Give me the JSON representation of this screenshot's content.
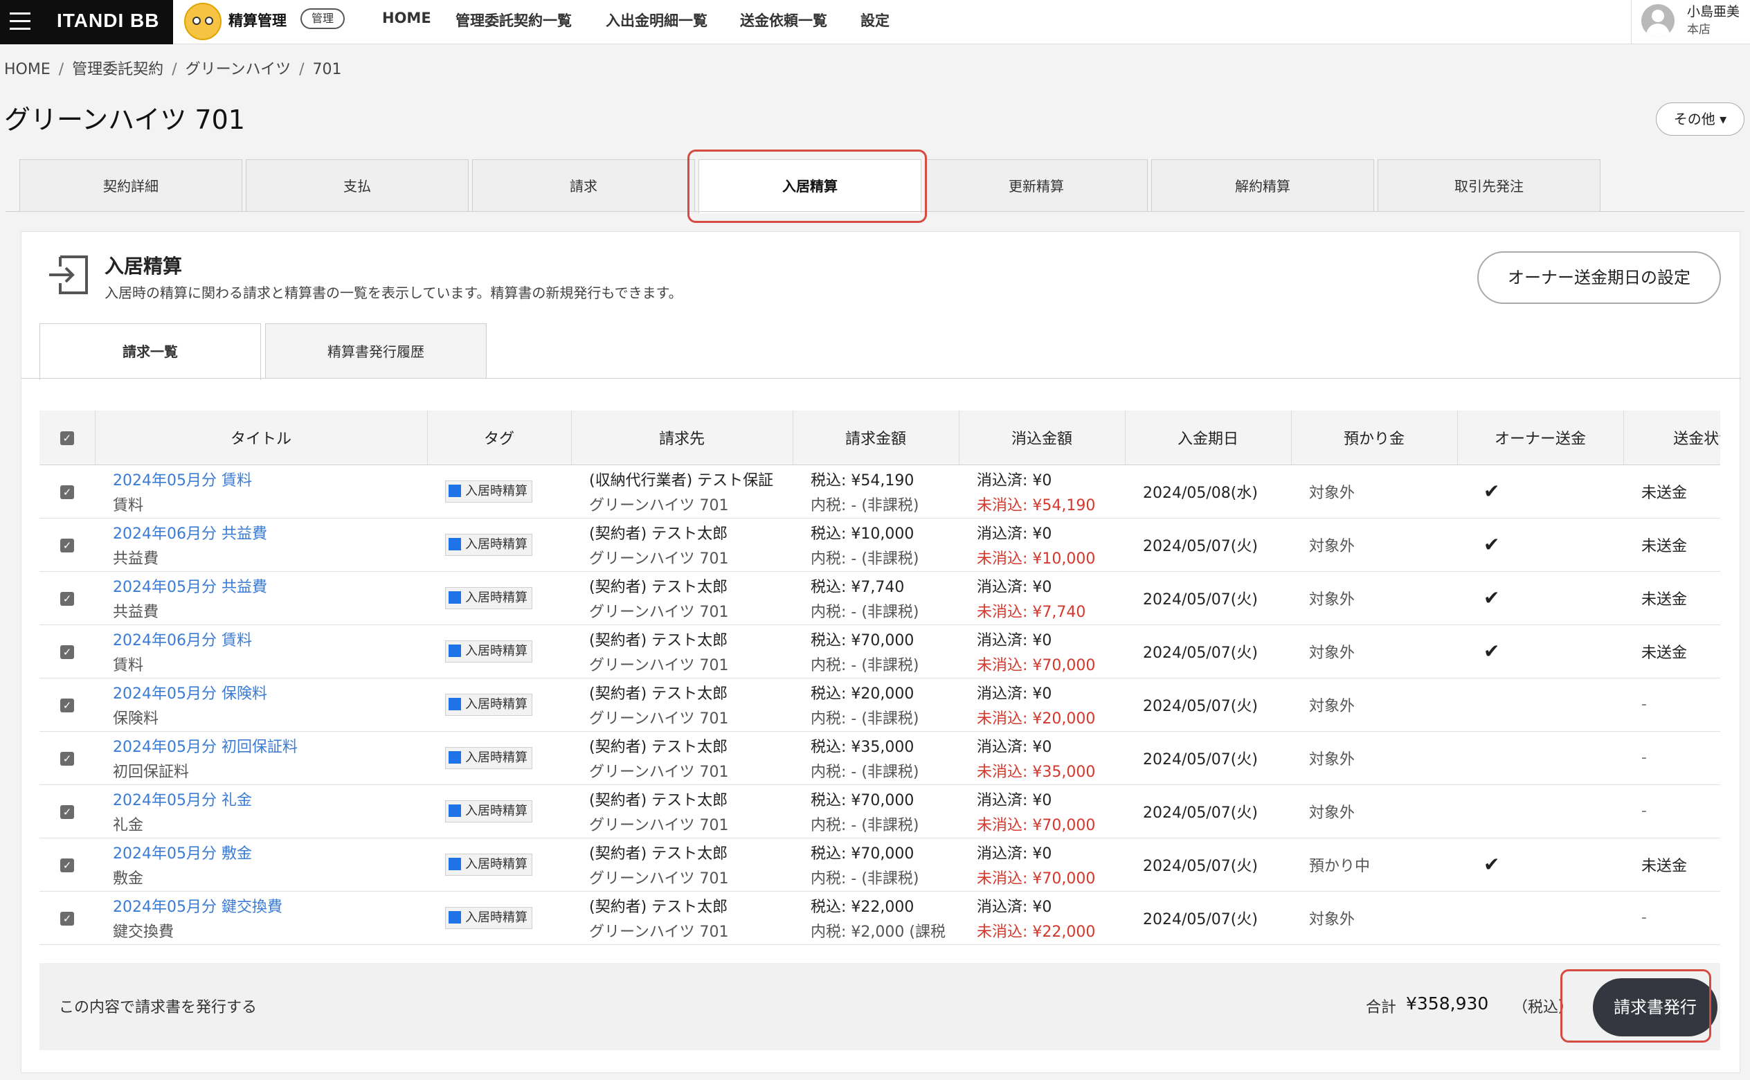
{
  "brand": {
    "name": "ITANDI BB"
  },
  "app": {
    "name": "精算管理",
    "badge": "管理"
  },
  "nav": [
    "HOME",
    "管理委託契約一覧",
    "入出金明細一覧",
    "送金依頼一覧",
    "設定"
  ],
  "user": {
    "name": "小島亜美",
    "branch": "本店"
  },
  "breadcrumb": [
    "HOME",
    "管理委託契約",
    "グリーンハイツ",
    "701"
  ],
  "page_title": "グリーンハイツ 701",
  "other_button": "その他 ▾",
  "tabs": [
    "契約詳細",
    "支払",
    "請求",
    "入居精算",
    "更新精算",
    "解約精算",
    "取引先発注"
  ],
  "active_tab": "入居精算",
  "section": {
    "title": "入居精算",
    "description": "入居時の精算に関わる請求と精算書の一覧を表示しています。精算書の新規発行もできます。",
    "owner_button": "オーナー送金期日の設定",
    "icon": "move-in-icon"
  },
  "subtabs": [
    "請求一覧",
    "精算書発行履歴"
  ],
  "table": {
    "headers": [
      "タイトル",
      "タグ",
      "請求先",
      "請求金額",
      "消込金額",
      "入金期日",
      "預かり金",
      "オーナー送金",
      "送金状況"
    ],
    "rows": [
      {
        "title": "2024年05月分 賃料",
        "subtitle": "賃料",
        "tag": "入居時精算",
        "payer": "(収納代行業者) テスト保証",
        "payer_sub": "グリーンハイツ 701",
        "amount": "税込: ¥54,190",
        "tax": "内税: - (非課税)",
        "cleared": "消込済: ¥0",
        "uncleared": "未消込: ¥54,190",
        "due": "2024/05/08(水)",
        "deposit": "対象外",
        "owner": "✔",
        "status": "未送金"
      },
      {
        "title": "2024年06月分 共益費",
        "subtitle": "共益費",
        "tag": "入居時精算",
        "payer": "(契約者) テスト太郎",
        "payer_sub": "グリーンハイツ 701",
        "amount": "税込: ¥10,000",
        "tax": "内税: - (非課税)",
        "cleared": "消込済: ¥0",
        "uncleared": "未消込: ¥10,000",
        "due": "2024/05/07(火)",
        "deposit": "対象外",
        "owner": "✔",
        "status": "未送金"
      },
      {
        "title": "2024年05月分 共益費",
        "subtitle": "共益費",
        "tag": "入居時精算",
        "payer": "(契約者) テスト太郎",
        "payer_sub": "グリーンハイツ 701",
        "amount": "税込: ¥7,740",
        "tax": "内税: - (非課税)",
        "cleared": "消込済: ¥0",
        "uncleared": "未消込: ¥7,740",
        "due": "2024/05/07(火)",
        "deposit": "対象外",
        "owner": "✔",
        "status": "未送金"
      },
      {
        "title": "2024年06月分 賃料",
        "subtitle": "賃料",
        "tag": "入居時精算",
        "payer": "(契約者) テスト太郎",
        "payer_sub": "グリーンハイツ 701",
        "amount": "税込: ¥70,000",
        "tax": "内税: - (非課税)",
        "cleared": "消込済: ¥0",
        "uncleared": "未消込: ¥70,000",
        "due": "2024/05/07(火)",
        "deposit": "対象外",
        "owner": "✔",
        "status": "未送金"
      },
      {
        "title": "2024年05月分 保険料",
        "subtitle": "保険料",
        "tag": "入居時精算",
        "payer": "(契約者) テスト太郎",
        "payer_sub": "グリーンハイツ 701",
        "amount": "税込: ¥20,000",
        "tax": "内税: - (非課税)",
        "cleared": "消込済: ¥0",
        "uncleared": "未消込: ¥20,000",
        "due": "2024/05/07(火)",
        "deposit": "対象外",
        "owner": "",
        "status": "-"
      },
      {
        "title": "2024年05月分 初回保証料",
        "subtitle": "初回保証料",
        "tag": "入居時精算",
        "payer": "(契約者) テスト太郎",
        "payer_sub": "グリーンハイツ 701",
        "amount": "税込: ¥35,000",
        "tax": "内税: - (非課税)",
        "cleared": "消込済: ¥0",
        "uncleared": "未消込: ¥35,000",
        "due": "2024/05/07(火)",
        "deposit": "対象外",
        "owner": "",
        "status": "-"
      },
      {
        "title": "2024年05月分 礼金",
        "subtitle": "礼金",
        "tag": "入居時精算",
        "payer": "(契約者) テスト太郎",
        "payer_sub": "グリーンハイツ 701",
        "amount": "税込: ¥70,000",
        "tax": "内税: - (非課税)",
        "cleared": "消込済: ¥0",
        "uncleared": "未消込: ¥70,000",
        "due": "2024/05/07(火)",
        "deposit": "対象外",
        "owner": "",
        "status": "-"
      },
      {
        "title": "2024年05月分 敷金",
        "subtitle": "敷金",
        "tag": "入居時精算",
        "payer": "(契約者) テスト太郎",
        "payer_sub": "グリーンハイツ 701",
        "amount": "税込: ¥70,000",
        "tax": "内税: - (非課税)",
        "cleared": "消込済: ¥0",
        "uncleared": "未消込: ¥70,000",
        "due": "2024/05/07(火)",
        "deposit": "預かり中",
        "owner": "✔",
        "status": "未送金"
      },
      {
        "title": "2024年05月分 鍵交換費",
        "subtitle": "鍵交換費",
        "tag": "入居時精算",
        "payer": "(契約者) テスト太郎",
        "payer_sub": "グリーンハイツ 701",
        "amount": "税込: ¥22,000",
        "tax": "内税: ¥2,000 (課税",
        "cleared": "消込済: ¥0",
        "uncleared": "未消込: ¥22,000",
        "due": "2024/05/07(火)",
        "deposit": "対象外",
        "owner": "",
        "status": "-"
      }
    ]
  },
  "footer": {
    "text": "この内容で請求書を発行する",
    "total_label": "合計",
    "total_value": "¥358,930",
    "tax_note": "（税込）",
    "issue_button": "請求書発行"
  },
  "colors": {
    "link": "#3a7bd5",
    "uncleared": "#d5372c",
    "tag": "#1e73e8",
    "highlight": "#d64b40",
    "button": "#34373f"
  }
}
